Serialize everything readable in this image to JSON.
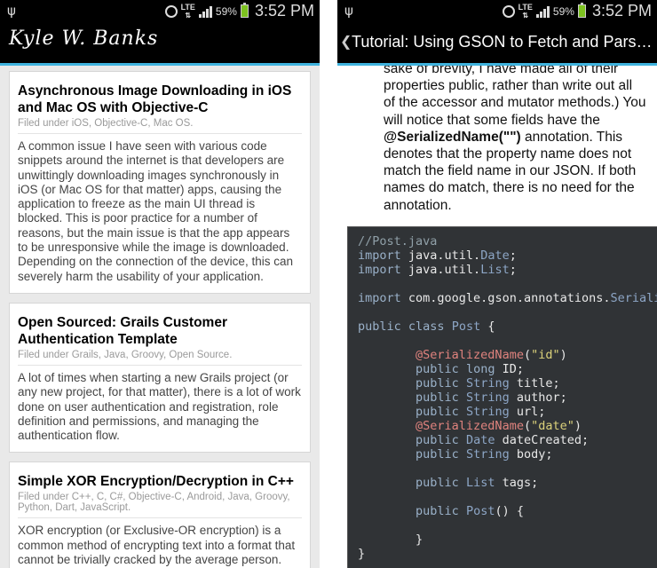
{
  "status_bar": {
    "time": "3:52 PM",
    "battery": "59%",
    "network": "LTE"
  },
  "left_screen": {
    "blog_title": "Kyle W. Banks",
    "posts": [
      {
        "title": "Asynchronous Image Downloading in iOS and Mac OS with Objective-C",
        "meta": "Filed under iOS, Objective-C, Mac OS.",
        "excerpt": "A common issue I have seen with various code snippets around the internet is that developers are unwittingly downloading images synchronously in iOS (or Mac OS for that matter) apps, causing the application to freeze as the main UI thread is blocked. This is poor practice for a number of reasons, but the main issue is that the app appears to be unresponsive while the image is downloaded. Depending on the connection of the device, this can severely harm the usability of your application."
      },
      {
        "title": "Open Sourced: Grails Customer Authentication Template",
        "meta": "Filed under Grails, Java, Groovy, Open Source.",
        "excerpt": "A lot of times when starting a new Grails project (or any new project, for that matter), there is a lot of work done on user authentication and registration, role definition and permissions, and managing the authentication flow."
      },
      {
        "title": "Simple XOR Encryption/Decryption in C++",
        "meta": "Filed under C++, C, C#, Objective-C, Android, Java, Groovy, Python, Dart, JavaScript.",
        "excerpt": "XOR encryption (or Exclusive-OR encryption) is a common method of encrypting text into a format that cannot be trivially cracked by the average person."
      }
    ]
  },
  "right_screen": {
    "title": "Tutorial: Using GSON to Fetch and Pars…",
    "para_before": "sake of brevity, I have made all of their properties public, rather than write out all of the accessor and mutator methods.) You will notice that some fields have the ",
    "para_bold": "@SerializedName(\"\")",
    "para_after": " annotation. This denotes that the property name does not match the field name in our JSON. If both names do match, there is no need for the annotation.",
    "code_lines": [
      [
        {
          "t": "//Post.java",
          "c": "com"
        }
      ],
      [
        {
          "t": "import ",
          "c": "kw"
        },
        {
          "t": "java.util.",
          "c": "pl"
        },
        {
          "t": "Date",
          "c": "ty"
        },
        {
          "t": ";",
          "c": "pl"
        }
      ],
      [
        {
          "t": "import ",
          "c": "kw"
        },
        {
          "t": "java.util.",
          "c": "pl"
        },
        {
          "t": "List",
          "c": "ty"
        },
        {
          "t": ";",
          "c": "pl"
        }
      ],
      [],
      [
        {
          "t": "import ",
          "c": "kw"
        },
        {
          "t": "com.google.gson.annotations.",
          "c": "pl"
        },
        {
          "t": "SerializedName",
          "c": "ty"
        },
        {
          "t": ";",
          "c": "pl"
        }
      ],
      [],
      [
        {
          "t": "public ",
          "c": "kw"
        },
        {
          "t": "class ",
          "c": "kw"
        },
        {
          "t": "Post",
          "c": "ty"
        },
        {
          "t": " {",
          "c": "pl"
        }
      ],
      [],
      [
        {
          "t": "        ",
          "c": "pl"
        },
        {
          "t": "@SerializedName",
          "c": "ann"
        },
        {
          "t": "(",
          "c": "pl"
        },
        {
          "t": "\"id\"",
          "c": "str"
        },
        {
          "t": ")",
          "c": "pl"
        }
      ],
      [
        {
          "t": "        ",
          "c": "pl"
        },
        {
          "t": "public ",
          "c": "kw"
        },
        {
          "t": "long ",
          "c": "kw"
        },
        {
          "t": "ID;",
          "c": "pl"
        }
      ],
      [
        {
          "t": "        ",
          "c": "pl"
        },
        {
          "t": "public ",
          "c": "kw"
        },
        {
          "t": "String ",
          "c": "ty"
        },
        {
          "t": "title;",
          "c": "pl"
        }
      ],
      [
        {
          "t": "        ",
          "c": "pl"
        },
        {
          "t": "public ",
          "c": "kw"
        },
        {
          "t": "String ",
          "c": "ty"
        },
        {
          "t": "author;",
          "c": "pl"
        }
      ],
      [
        {
          "t": "        ",
          "c": "pl"
        },
        {
          "t": "public ",
          "c": "kw"
        },
        {
          "t": "String ",
          "c": "ty"
        },
        {
          "t": "url;",
          "c": "pl"
        }
      ],
      [
        {
          "t": "        ",
          "c": "pl"
        },
        {
          "t": "@SerializedName",
          "c": "ann"
        },
        {
          "t": "(",
          "c": "pl"
        },
        {
          "t": "\"date\"",
          "c": "str"
        },
        {
          "t": ")",
          "c": "pl"
        }
      ],
      [
        {
          "t": "        ",
          "c": "pl"
        },
        {
          "t": "public ",
          "c": "kw"
        },
        {
          "t": "Date ",
          "c": "ty"
        },
        {
          "t": "dateCreated;",
          "c": "pl"
        }
      ],
      [
        {
          "t": "        ",
          "c": "pl"
        },
        {
          "t": "public ",
          "c": "kw"
        },
        {
          "t": "String ",
          "c": "ty"
        },
        {
          "t": "body;",
          "c": "pl"
        }
      ],
      [],
      [
        {
          "t": "        ",
          "c": "pl"
        },
        {
          "t": "public ",
          "c": "kw"
        },
        {
          "t": "List ",
          "c": "ty"
        },
        {
          "t": "tags;",
          "c": "pl"
        }
      ],
      [],
      [
        {
          "t": "        ",
          "c": "pl"
        },
        {
          "t": "public ",
          "c": "kw"
        },
        {
          "t": "Post",
          "c": "ty"
        },
        {
          "t": "() {",
          "c": "pl"
        }
      ],
      [],
      [
        {
          "t": "        }",
          "c": "pl"
        }
      ],
      [
        {
          "t": "}",
          "c": "pl"
        }
      ]
    ]
  },
  "colors": {
    "accent": "#3fb3de",
    "code_bg": "#303336",
    "annotation": "#e0837e",
    "string": "#dcd27b"
  }
}
